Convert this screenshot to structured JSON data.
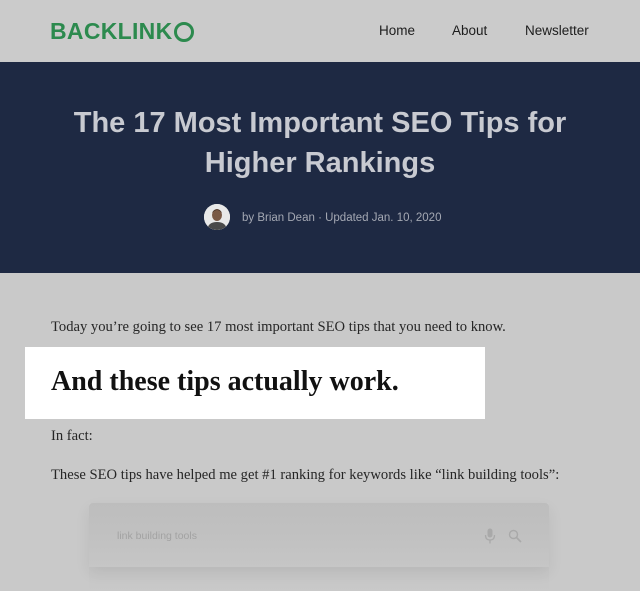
{
  "header": {
    "logo_text": "BACKLINK",
    "nav": {
      "home": "Home",
      "about": "About",
      "newsletter": "Newsletter"
    }
  },
  "hero": {
    "title_line1": "The 17 Most Important SEO Tips for",
    "title_line2": "Higher Rankings",
    "byline": "by Brian Dean · Updated Jan. 10, 2020"
  },
  "article": {
    "intro": "Today you’re going to see 17 most important SEO tips that you need to know.",
    "callout": "And these tips actually work.",
    "in_fact": "In fact:",
    "tips_sentence": "These SEO tips have helped me get #1 ranking for keywords like “link building tools”:"
  },
  "search_screenshot": {
    "query": "link building tools",
    "icons": [
      "microphone-icon",
      "search-icon"
    ]
  },
  "colors": {
    "brand_green": "#2c8a4e",
    "hero_navy": "#1e2943",
    "overlay_gray": "#c9c9c9"
  }
}
